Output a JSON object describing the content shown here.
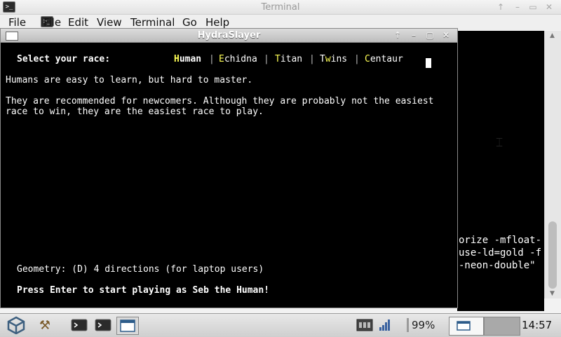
{
  "background_window": {
    "title": "Terminal",
    "menu": [
      "File",
      "Edit",
      "View",
      "Terminal",
      "Go",
      "Help"
    ],
    "text_lines": [
      "orize -mfloat-",
      "use-ld=gold -f",
      "-neon-double\""
    ]
  },
  "game_window": {
    "title": "HydraSlayer",
    "prompt": "Select your race:",
    "races": [
      {
        "hotkey": "H",
        "rest": "uman",
        "selected": true
      },
      {
        "hotkey": "E",
        "rest": "chidna",
        "selected": false
      },
      {
        "hotkey": "T",
        "rest": "itan",
        "selected": false
      },
      {
        "prefix": "T",
        "hotkey": "w",
        "rest": "ins",
        "selected": false
      },
      {
        "hotkey": "C",
        "rest": "entaur",
        "selected": false
      }
    ],
    "separator": "|",
    "description_line1": "Humans are easy to learn, but hard to master.",
    "description_line2": "They are recommended for newcomers. Although they are probably not the easiest",
    "description_line3": "race to win, they are the easiest race to play.",
    "geometry": "Geometry: (D) 4 directions (for laptop users)",
    "start_prompt": "Press Enter to start playing as Seb the Human!",
    "hotkey_color": "#ffff55"
  },
  "taskbar": {
    "battery": "99%",
    "clock": "14:57"
  }
}
